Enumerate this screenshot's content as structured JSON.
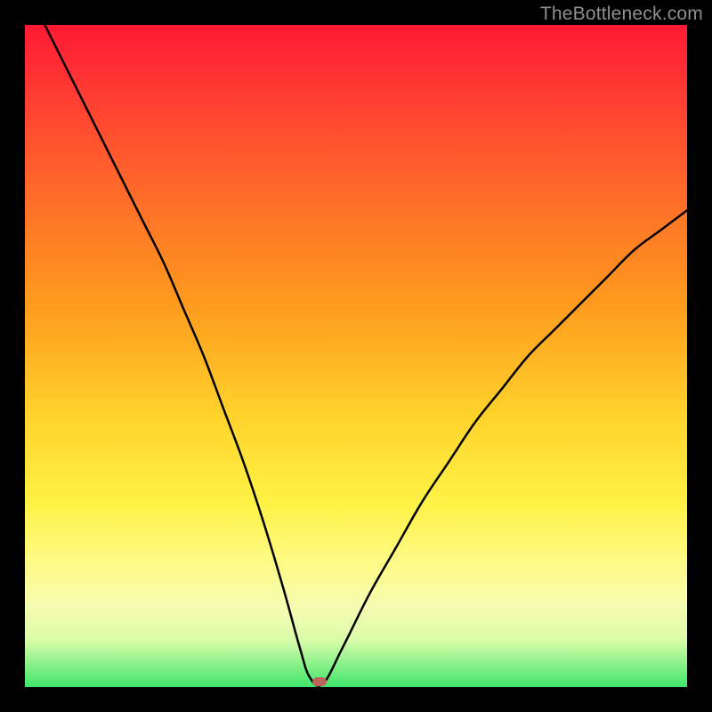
{
  "watermark": "TheBottleneck.com",
  "chart_data": {
    "type": "line",
    "title": "",
    "xlabel": "",
    "ylabel": "",
    "xlim": [
      0,
      100
    ],
    "ylim": [
      0,
      100
    ],
    "series": [
      {
        "name": "bottleneck-curve",
        "x": [
          0,
          3,
          6,
          9,
          12,
          15,
          18,
          21,
          24,
          27,
          30,
          33,
          36,
          39,
          41.5,
          43,
          45,
          48,
          52,
          56,
          60,
          64,
          68,
          72,
          76,
          80,
          84,
          88,
          92,
          96,
          100
        ],
        "values": [
          106,
          100,
          94,
          88,
          82,
          76,
          70,
          64,
          57,
          50,
          42,
          34,
          25,
          15,
          6,
          1.5,
          0.5,
          6,
          14,
          21,
          28,
          34,
          40,
          45,
          50,
          54,
          58,
          62,
          66,
          69,
          72
        ]
      }
    ],
    "marker": {
      "x": 44.5,
      "y": 0.8,
      "color": "#c0655d"
    },
    "gradient_stops": [
      {
        "pos": 0,
        "color": "#ff1a33"
      },
      {
        "pos": 10,
        "color": "#ff3a33"
      },
      {
        "pos": 25,
        "color": "#ff6a2a"
      },
      {
        "pos": 42,
        "color": "#ff9a1e"
      },
      {
        "pos": 58,
        "color": "#ffd02a"
      },
      {
        "pos": 72,
        "color": "#fff244"
      },
      {
        "pos": 82,
        "color": "#fdfb8c"
      },
      {
        "pos": 88,
        "color": "#f6fcb2"
      },
      {
        "pos": 93,
        "color": "#d8fcaa"
      },
      {
        "pos": 100,
        "color": "#3fe66a"
      }
    ]
  }
}
